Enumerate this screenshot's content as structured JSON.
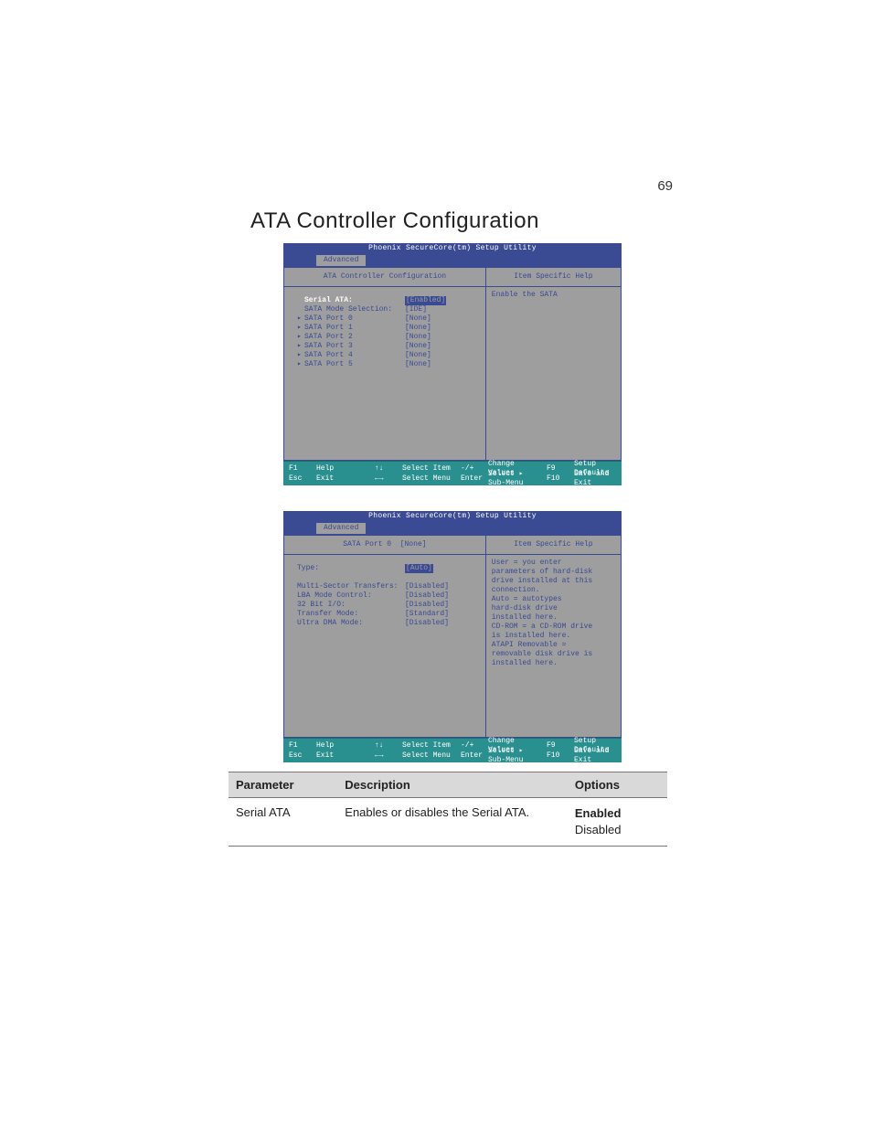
{
  "page_number": "69",
  "section_title": "ATA Controller Configuration",
  "bios1": {
    "app_title": "Phoenix SecureCore(tm) Setup Utility",
    "tab": "Advanced",
    "left_header": "ATA Controller Configuration",
    "right_header": "Item Specific Help",
    "help_text": "Enable the SATA",
    "items": [
      {
        "label": "Serial ATA:",
        "value": "[Enabled]",
        "selected": true,
        "sub": false,
        "sel_label": true
      },
      {
        "label": "SATA Mode Selection:",
        "value": "[IDE]",
        "selected": false,
        "sub": false
      },
      {
        "label": "SATA Port 0",
        "value": "[None]",
        "selected": false,
        "sub": true
      },
      {
        "label": "SATA Port 1",
        "value": "[None]",
        "selected": false,
        "sub": true
      },
      {
        "label": "SATA Port 2",
        "value": "[None]",
        "selected": false,
        "sub": true
      },
      {
        "label": "SATA Port 3",
        "value": "[None]",
        "selected": false,
        "sub": true
      },
      {
        "label": "SATA Port 4",
        "value": "[None]",
        "selected": false,
        "sub": true
      },
      {
        "label": "SATA Port 5",
        "value": "[None]",
        "selected": false,
        "sub": true
      }
    ],
    "footer": {
      "r1k1": "F1",
      "r1t1": "Help",
      "r1k2": "↑↓",
      "r1t2": "Select Item",
      "r1k3": "-/+",
      "r1t3": "Change Values",
      "r1k4": "F9",
      "r1t4": "Setup Defaults",
      "r2k1": "Esc",
      "r2t1": "Exit",
      "r2k2": "←→",
      "r2t2": "Select Menu",
      "r2k3": "Enter",
      "r2t3": "Select ▸ Sub-Menu",
      "r2k4": "F10",
      "r2t4": "Save and Exit"
    }
  },
  "bios2": {
    "app_title": "Phoenix SecureCore(tm) Setup Utility",
    "tab": "Advanced",
    "left_header_label": "SATA Port 0",
    "left_header_value": "[None]",
    "right_header": "Item Specific Help",
    "help_lines": [
      "User = you enter",
      "parameters of hard-disk",
      "drive installed at this",
      "connection.",
      "Auto = autotypes",
      "hard-disk drive",
      "installed here.",
      "CD-ROM = a CD-ROM drive",
      "is installed here.",
      "ATAPI Removable =",
      "removable disk drive is",
      "installed here."
    ],
    "items": [
      {
        "label": "Type:",
        "value": "[Auto]",
        "selected": true
      },
      {
        "spacer": true
      },
      {
        "label": "Multi-Sector Transfers:",
        "value": "[Disabled]"
      },
      {
        "label": "LBA Mode Control:",
        "value": "[Disabled]"
      },
      {
        "label": "32 Bit I/O:",
        "value": "[Disabled]"
      },
      {
        "label": "Transfer Mode:",
        "value": "[Standard]"
      },
      {
        "label": "Ultra DMA Mode:",
        "value": "[Disabled]"
      }
    ],
    "footer": {
      "r1k1": "F1",
      "r1t1": "Help",
      "r1k2": "↑↓",
      "r1t2": "Select Item",
      "r1k3": "-/+",
      "r1t3": "Change Values",
      "r1k4": "F9",
      "r1t4": "Setup Defaults",
      "r2k1": "Esc",
      "r2t1": "Exit",
      "r2k2": "←→",
      "r2t2": "Select Menu",
      "r2k3": "Enter",
      "r2t3": "Select ▸ Sub-Menu",
      "r2k4": "F10",
      "r2t4": "Save and Exit"
    }
  },
  "table": {
    "head": {
      "c1": "Parameter",
      "c2": "Description",
      "c3": "Options"
    },
    "rows": [
      {
        "param": "Serial ATA",
        "desc": "Enables or disables the Serial ATA.",
        "opt1": "Enabled",
        "opt2": "Disabled"
      }
    ]
  }
}
